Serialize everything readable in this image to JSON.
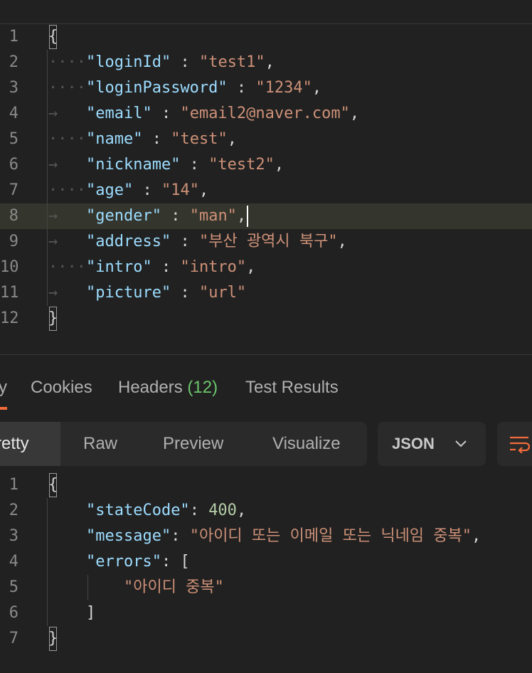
{
  "request_body": {
    "lines": [
      {
        "n": "1",
        "ws": "",
        "key": "",
        "sep": "",
        "val": "",
        "val_type": "",
        "brace": "{",
        "active": false
      },
      {
        "n": "2",
        "ws": "····",
        "key": "\"loginId\"",
        "sep": " : ",
        "val": "\"test1\"",
        "val_type": "str",
        "tail": ",",
        "active": false
      },
      {
        "n": "3",
        "ws": "····",
        "key": "\"loginPassword\"",
        "sep": " : ",
        "val": "\"1234\"",
        "val_type": "str",
        "tail": ",",
        "active": false
      },
      {
        "n": "4",
        "ws": "→   ",
        "key": "\"email\"",
        "sep": " : ",
        "val": "\"email2@naver.com\"",
        "val_type": "str",
        "tail": ",",
        "active": false
      },
      {
        "n": "5",
        "ws": "····",
        "key": "\"name\"",
        "sep": " : ",
        "val": "\"test\"",
        "val_type": "str",
        "tail": ",",
        "active": false
      },
      {
        "n": "6",
        "ws": "→   ",
        "key": "\"nickname\"",
        "sep": " : ",
        "val": "\"test2\"",
        "val_type": "str",
        "tail": ",",
        "active": false
      },
      {
        "n": "7",
        "ws": "····",
        "key": "\"age\"",
        "sep": " : ",
        "val": "\"14\"",
        "val_type": "str",
        "tail": ",",
        "active": false
      },
      {
        "n": "8",
        "ws": "→   ",
        "key": "\"gender\"",
        "sep": " : ",
        "val": "\"man\"",
        "val_type": "str",
        "tail": ",",
        "active": true
      },
      {
        "n": "9",
        "ws": "→   ",
        "key": "\"address\"",
        "sep": " : ",
        "val": "\"부산 광역시 북구\"",
        "val_type": "str",
        "tail": ",",
        "active": false
      },
      {
        "n": "10",
        "ws": "····",
        "key": "\"intro\"",
        "sep": " : ",
        "val": "\"intro\"",
        "val_type": "str",
        "tail": ",",
        "active": false
      },
      {
        "n": "11",
        "ws": "→   ",
        "key": "\"picture\"",
        "sep": " : ",
        "val": "\"url\"",
        "val_type": "str",
        "tail": "",
        "active": false
      },
      {
        "n": "12",
        "ws": "",
        "key": "",
        "sep": "",
        "val": "",
        "val_type": "",
        "brace": "}",
        "active": false
      }
    ]
  },
  "response_tabs": {
    "body_partial": "y",
    "cookies": "Cookies",
    "headers": "Headers",
    "headers_count": "(12)",
    "test_results": "Test Results"
  },
  "view_modes": {
    "pretty": "retty",
    "raw": "Raw",
    "preview": "Preview",
    "visualize": "Visualize"
  },
  "format_select": {
    "value": "JSON"
  },
  "colors": {
    "accent": "#f26b3a",
    "key": "#9cdcfe",
    "string": "#ce9178",
    "number": "#b5cea8",
    "count": "#6cc56c"
  },
  "response_body": {
    "lines": [
      {
        "n": "1",
        "indent": "",
        "key": "",
        "sep": "",
        "val": "",
        "val_type": "",
        "brace": "{"
      },
      {
        "n": "2",
        "indent": "    ",
        "key": "\"stateCode\"",
        "sep": ": ",
        "val": "400",
        "val_type": "num",
        "tail": ","
      },
      {
        "n": "3",
        "indent": "    ",
        "key": "\"message\"",
        "sep": ": ",
        "val": "\"아이디 또는 이메일 또는 닉네임 중복\"",
        "val_type": "str",
        "tail": ","
      },
      {
        "n": "4",
        "indent": "    ",
        "key": "\"errors\"",
        "sep": ": ",
        "val": "[",
        "val_type": "punc",
        "tail": ""
      },
      {
        "n": "5",
        "indent": "        ",
        "key": "",
        "sep": "",
        "val": "\"아이디 중복\"",
        "val_type": "str",
        "tail": ""
      },
      {
        "n": "6",
        "indent": "    ",
        "key": "",
        "sep": "",
        "val": "]",
        "val_type": "punc",
        "tail": ""
      },
      {
        "n": "7",
        "indent": "",
        "key": "",
        "sep": "",
        "val": "",
        "val_type": "",
        "brace": "}"
      }
    ]
  }
}
